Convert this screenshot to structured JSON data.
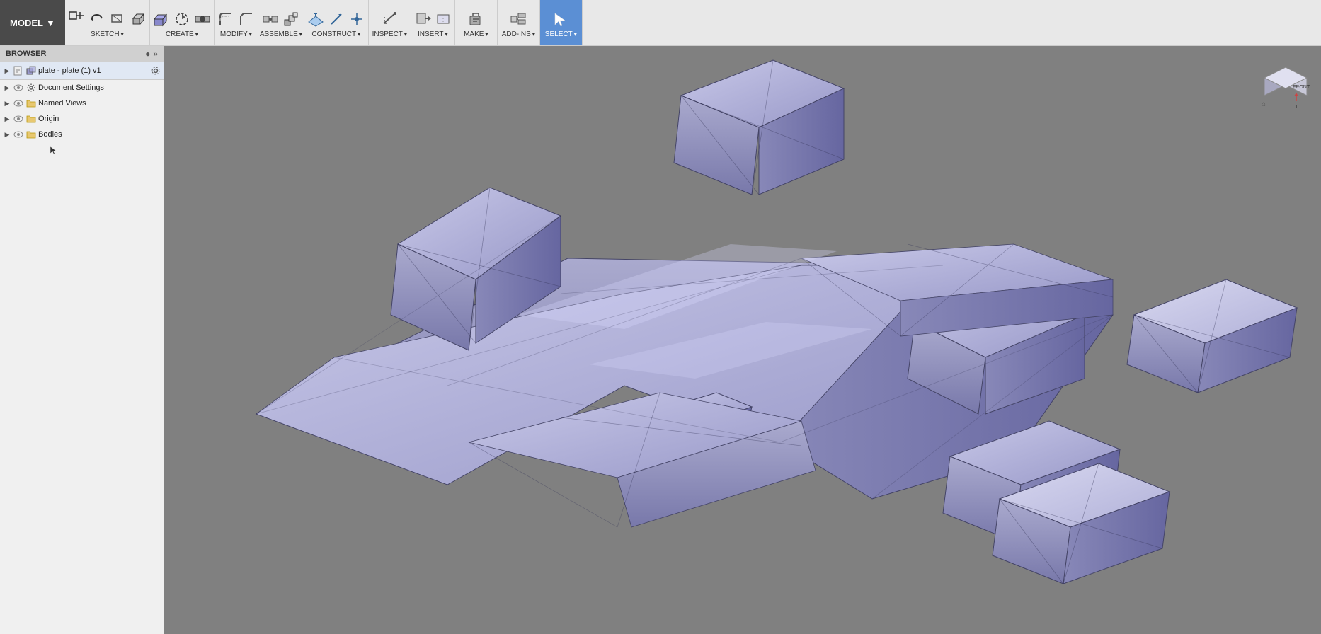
{
  "toolbar": {
    "model_label": "MODEL",
    "model_arrow": "▼",
    "groups": [
      {
        "id": "sketch",
        "label": "SKETCH",
        "has_dropdown": true,
        "icons": [
          "sketch-box-icon",
          "undo-icon",
          "rectangle-icon",
          "extrude-icon"
        ]
      },
      {
        "id": "create",
        "label": "CREATE",
        "has_dropdown": true,
        "icons": [
          "create-extrude-icon",
          "create-revolve-icon",
          "create-hole-icon"
        ]
      },
      {
        "id": "modify",
        "label": "MODIFY",
        "has_dropdown": true,
        "icons": [
          "modify-fillet-icon",
          "modify-chamfer-icon"
        ]
      },
      {
        "id": "assemble",
        "label": "ASSEMBLE",
        "has_dropdown": true,
        "icons": [
          "assemble-joint-icon",
          "assemble-component-icon"
        ]
      },
      {
        "id": "construct",
        "label": "CONSTRUCT",
        "has_dropdown": true,
        "icons": [
          "construct-plane-icon",
          "construct-axis-icon"
        ]
      },
      {
        "id": "inspect",
        "label": "INSPECT",
        "has_dropdown": true,
        "icons": [
          "inspect-measure-icon"
        ]
      },
      {
        "id": "insert",
        "label": "INSERT",
        "has_dropdown": true,
        "icons": [
          "insert-icon"
        ]
      },
      {
        "id": "make",
        "label": "MAKE",
        "has_dropdown": true,
        "icons": [
          "make-icon"
        ]
      },
      {
        "id": "add_ins",
        "label": "ADD-INS",
        "has_dropdown": true,
        "icons": [
          "addins-icon"
        ]
      },
      {
        "id": "select",
        "label": "SELECT",
        "has_dropdown": true,
        "icons": [
          "select-icon"
        ],
        "selected": true
      }
    ]
  },
  "browser": {
    "title": "BROWSER",
    "pin_icon": "📌",
    "expand_icon": "»",
    "root_item": {
      "label": "plate - plate (1) v1",
      "has_settings": true
    },
    "items": [
      {
        "id": "document-settings",
        "label": "Document Settings",
        "has_eye": true,
        "has_expand": true,
        "indent": 0,
        "icon": "gear"
      },
      {
        "id": "named-views",
        "label": "Named Views",
        "has_eye": true,
        "has_expand": true,
        "indent": 0,
        "icon": "folder"
      },
      {
        "id": "origin",
        "label": "Origin",
        "has_eye": true,
        "has_expand": true,
        "indent": 0,
        "icon": "folder"
      },
      {
        "id": "bodies",
        "label": "Bodies",
        "has_eye": true,
        "has_expand": true,
        "indent": 0,
        "icon": "folder"
      }
    ]
  },
  "viewport": {
    "background_color": "#808080"
  },
  "nav_cube": {
    "front_label": "FRONT",
    "house_label": "⌂"
  },
  "colors": {
    "toolbar_bg": "#e8e8e8",
    "toolbar_dark": "#4a4a4a",
    "browser_bg": "#f0f0f0",
    "browser_header": "#d0d0d0",
    "viewport_bg": "#808080",
    "selected_tool": "#5b8fd4",
    "model_color": "#9999cc",
    "model_shadow": "#555577"
  }
}
